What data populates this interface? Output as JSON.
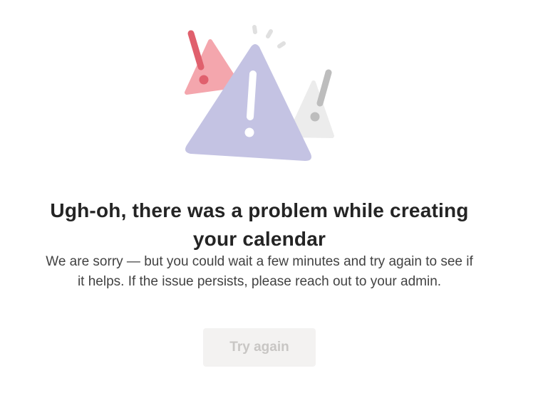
{
  "error": {
    "title": "Ugh-oh, there was a problem while creating your calendar",
    "message": "We are sorry — but you could wait a few minutes and try again to see if it helps. If the issue persists, please reach out to your admin.",
    "retry_button_label": "Try again",
    "retry_button_state": "disabled"
  },
  "illustration": {
    "icon": "warning-triangles-illustration",
    "colors": {
      "main_triangle": "#c4c3e3",
      "left_triangle": "#f4a6ad",
      "left_mark": "#e0606d",
      "right_triangle": "#eaeaea",
      "right_mark": "#bdbdbd",
      "sparks": "#e0e0e0"
    }
  }
}
